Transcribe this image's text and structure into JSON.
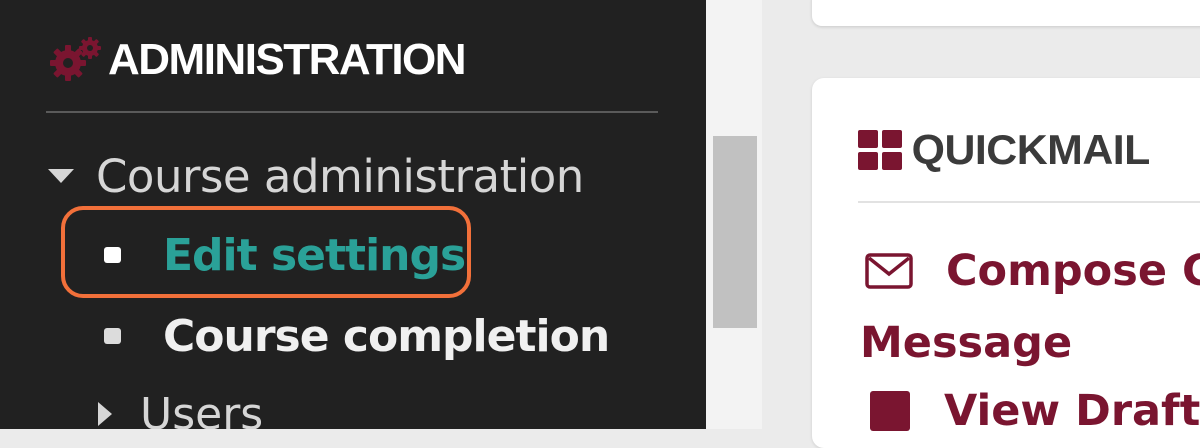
{
  "sidebar": {
    "title": "ADMINISTRATION",
    "section": {
      "label": "Course administration",
      "expanded": true,
      "items": [
        {
          "label": "Edit settings",
          "highlighted": true
        },
        {
          "label": "Course completion",
          "highlighted": false
        }
      ]
    },
    "collapsed_node": {
      "label": "Users"
    }
  },
  "quickmail": {
    "title": "QUICKMAIL",
    "links": {
      "compose": {
        "line1": "Compose C",
        "line2": "Message"
      },
      "drafts": {
        "label": "View Drafts"
      }
    }
  },
  "colors": {
    "sidebar_bg": "#212121",
    "accent_maroon": "#7a1530",
    "active_teal": "#2aa198",
    "highlight_orange": "#f2703a"
  },
  "icons": [
    "gears-icon",
    "caret-down-icon",
    "bullet-icon",
    "caret-right-icon",
    "grid-icon",
    "envelope-icon",
    "draft-icon"
  ]
}
